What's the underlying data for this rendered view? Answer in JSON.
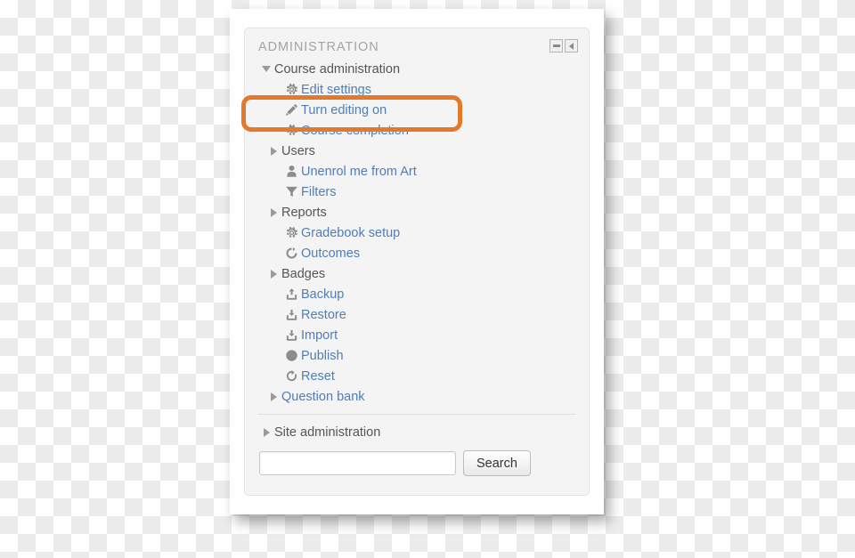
{
  "block": {
    "title": "ADMINISTRATION",
    "header_icons": [
      {
        "name": "collapse-icon",
        "glyph": "minus"
      },
      {
        "name": "dock-icon",
        "glyph": "left-arrow"
      }
    ],
    "tree": [
      {
        "id": "course-administration",
        "label": "Course administration",
        "marker": "tri-down",
        "icon": "none",
        "type": "plain",
        "indent": "root"
      },
      {
        "id": "edit-settings",
        "label": "Edit settings",
        "marker": "none",
        "icon": "gear-icon",
        "type": "link",
        "indent": "child"
      },
      {
        "id": "turn-editing-on",
        "label": "Turn editing on",
        "marker": "none",
        "icon": "pencil-icon",
        "type": "link",
        "indent": "child"
      },
      {
        "id": "course-completion",
        "label": "Course completion",
        "marker": "none",
        "icon": "gear-icon",
        "type": "link",
        "indent": "child"
      },
      {
        "id": "users",
        "label": "Users",
        "marker": "tri-right",
        "icon": "none",
        "type": "plain",
        "indent": "child"
      },
      {
        "id": "unenrol-me-from-art",
        "label": "Unenrol me from Art",
        "marker": "none",
        "icon": "user-icon",
        "type": "link",
        "indent": "child"
      },
      {
        "id": "filters",
        "label": "Filters",
        "marker": "none",
        "icon": "funnel-icon",
        "type": "link",
        "indent": "child"
      },
      {
        "id": "reports",
        "label": "Reports",
        "marker": "tri-right",
        "icon": "none",
        "type": "plain",
        "indent": "child"
      },
      {
        "id": "gradebook-setup",
        "label": "Gradebook setup",
        "marker": "none",
        "icon": "gear-icon",
        "type": "link",
        "indent": "child"
      },
      {
        "id": "outcomes",
        "label": "Outcomes",
        "marker": "none",
        "icon": "outcomes-icon",
        "type": "link",
        "indent": "child"
      },
      {
        "id": "badges",
        "label": "Badges",
        "marker": "tri-right",
        "icon": "none",
        "type": "plain",
        "indent": "child"
      },
      {
        "id": "backup",
        "label": "Backup",
        "marker": "none",
        "icon": "upload-icon",
        "type": "link",
        "indent": "child"
      },
      {
        "id": "restore",
        "label": "Restore",
        "marker": "none",
        "icon": "download-icon",
        "type": "link",
        "indent": "child"
      },
      {
        "id": "import",
        "label": "Import",
        "marker": "none",
        "icon": "download-icon",
        "type": "link",
        "indent": "child"
      },
      {
        "id": "publish",
        "label": "Publish",
        "marker": "none",
        "icon": "globe-icon",
        "type": "link",
        "indent": "child"
      },
      {
        "id": "reset",
        "label": "Reset",
        "marker": "none",
        "icon": "reset-icon",
        "type": "link",
        "indent": "child"
      },
      {
        "id": "question-bank",
        "label": "Question bank",
        "marker": "tri-right",
        "icon": "none",
        "type": "link",
        "indent": "child"
      }
    ],
    "site_administration": {
      "label": "Site administration",
      "marker": "tri-right"
    },
    "search": {
      "value": "",
      "placeholder": "",
      "button_label": "Search"
    }
  },
  "annotation": {
    "shape": "rounded-rectangle",
    "color": "#e3792a",
    "targets": "Turn editing on"
  },
  "colors": {
    "link": "#4e7eb8",
    "plain_text": "#555555",
    "title": "#a4a4a4",
    "block_bg": "#f4f4f4",
    "icon": "#8c8c8c",
    "highlight": "#e3792a"
  }
}
